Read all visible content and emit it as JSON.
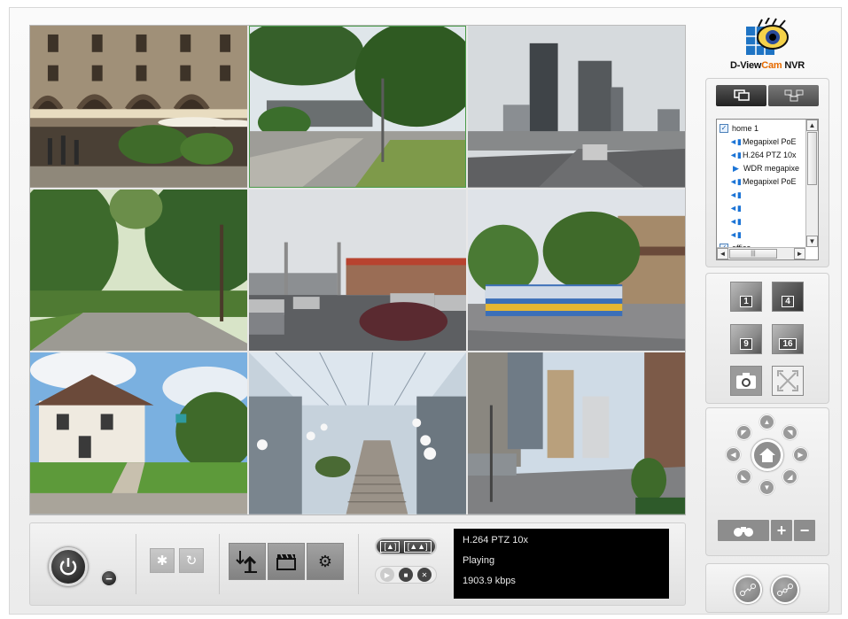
{
  "app": {
    "logo_title_a": "D-View",
    "logo_title_b": "Cam",
    "logo_title_c": " NVR"
  },
  "icons": {
    "power": "power-icon",
    "minus": "minus-icon",
    "snapshot": "camera-icon",
    "fullscreen": "fullscreen-icon",
    "settings": "gear-icon"
  },
  "camera_tree": {
    "groups": [
      {
        "label": "home 1",
        "checked": true
      },
      {
        "label": "office",
        "checked": true
      }
    ],
    "cameras": [
      {
        "label": "Megapixel PoE",
        "icon": "camera-icon"
      },
      {
        "label": "H.264 PTZ 10x",
        "icon": "camera-icon"
      },
      {
        "label": "WDR megapixe",
        "icon": "play-icon"
      },
      {
        "label": "Megapixel PoE",
        "icon": "camera-icon"
      },
      {
        "label": "",
        "icon": "camera-icon"
      },
      {
        "label": "",
        "icon": "camera-icon"
      },
      {
        "label": "",
        "icon": "camera-icon"
      },
      {
        "label": "",
        "icon": "camera-icon"
      }
    ]
  },
  "layout_buttons": {
    "one": "1",
    "four": "4",
    "nine": "9",
    "sixteen": "16"
  },
  "status": {
    "camera_name": "H.264 PTZ 10x",
    "state": "Playing",
    "bitrate": "1903.9 kbps"
  },
  "colors": {
    "selected_tile_border": "#4a9b4a",
    "tree_icon": "#1b74d6",
    "logo_accent": "#e66b00"
  }
}
